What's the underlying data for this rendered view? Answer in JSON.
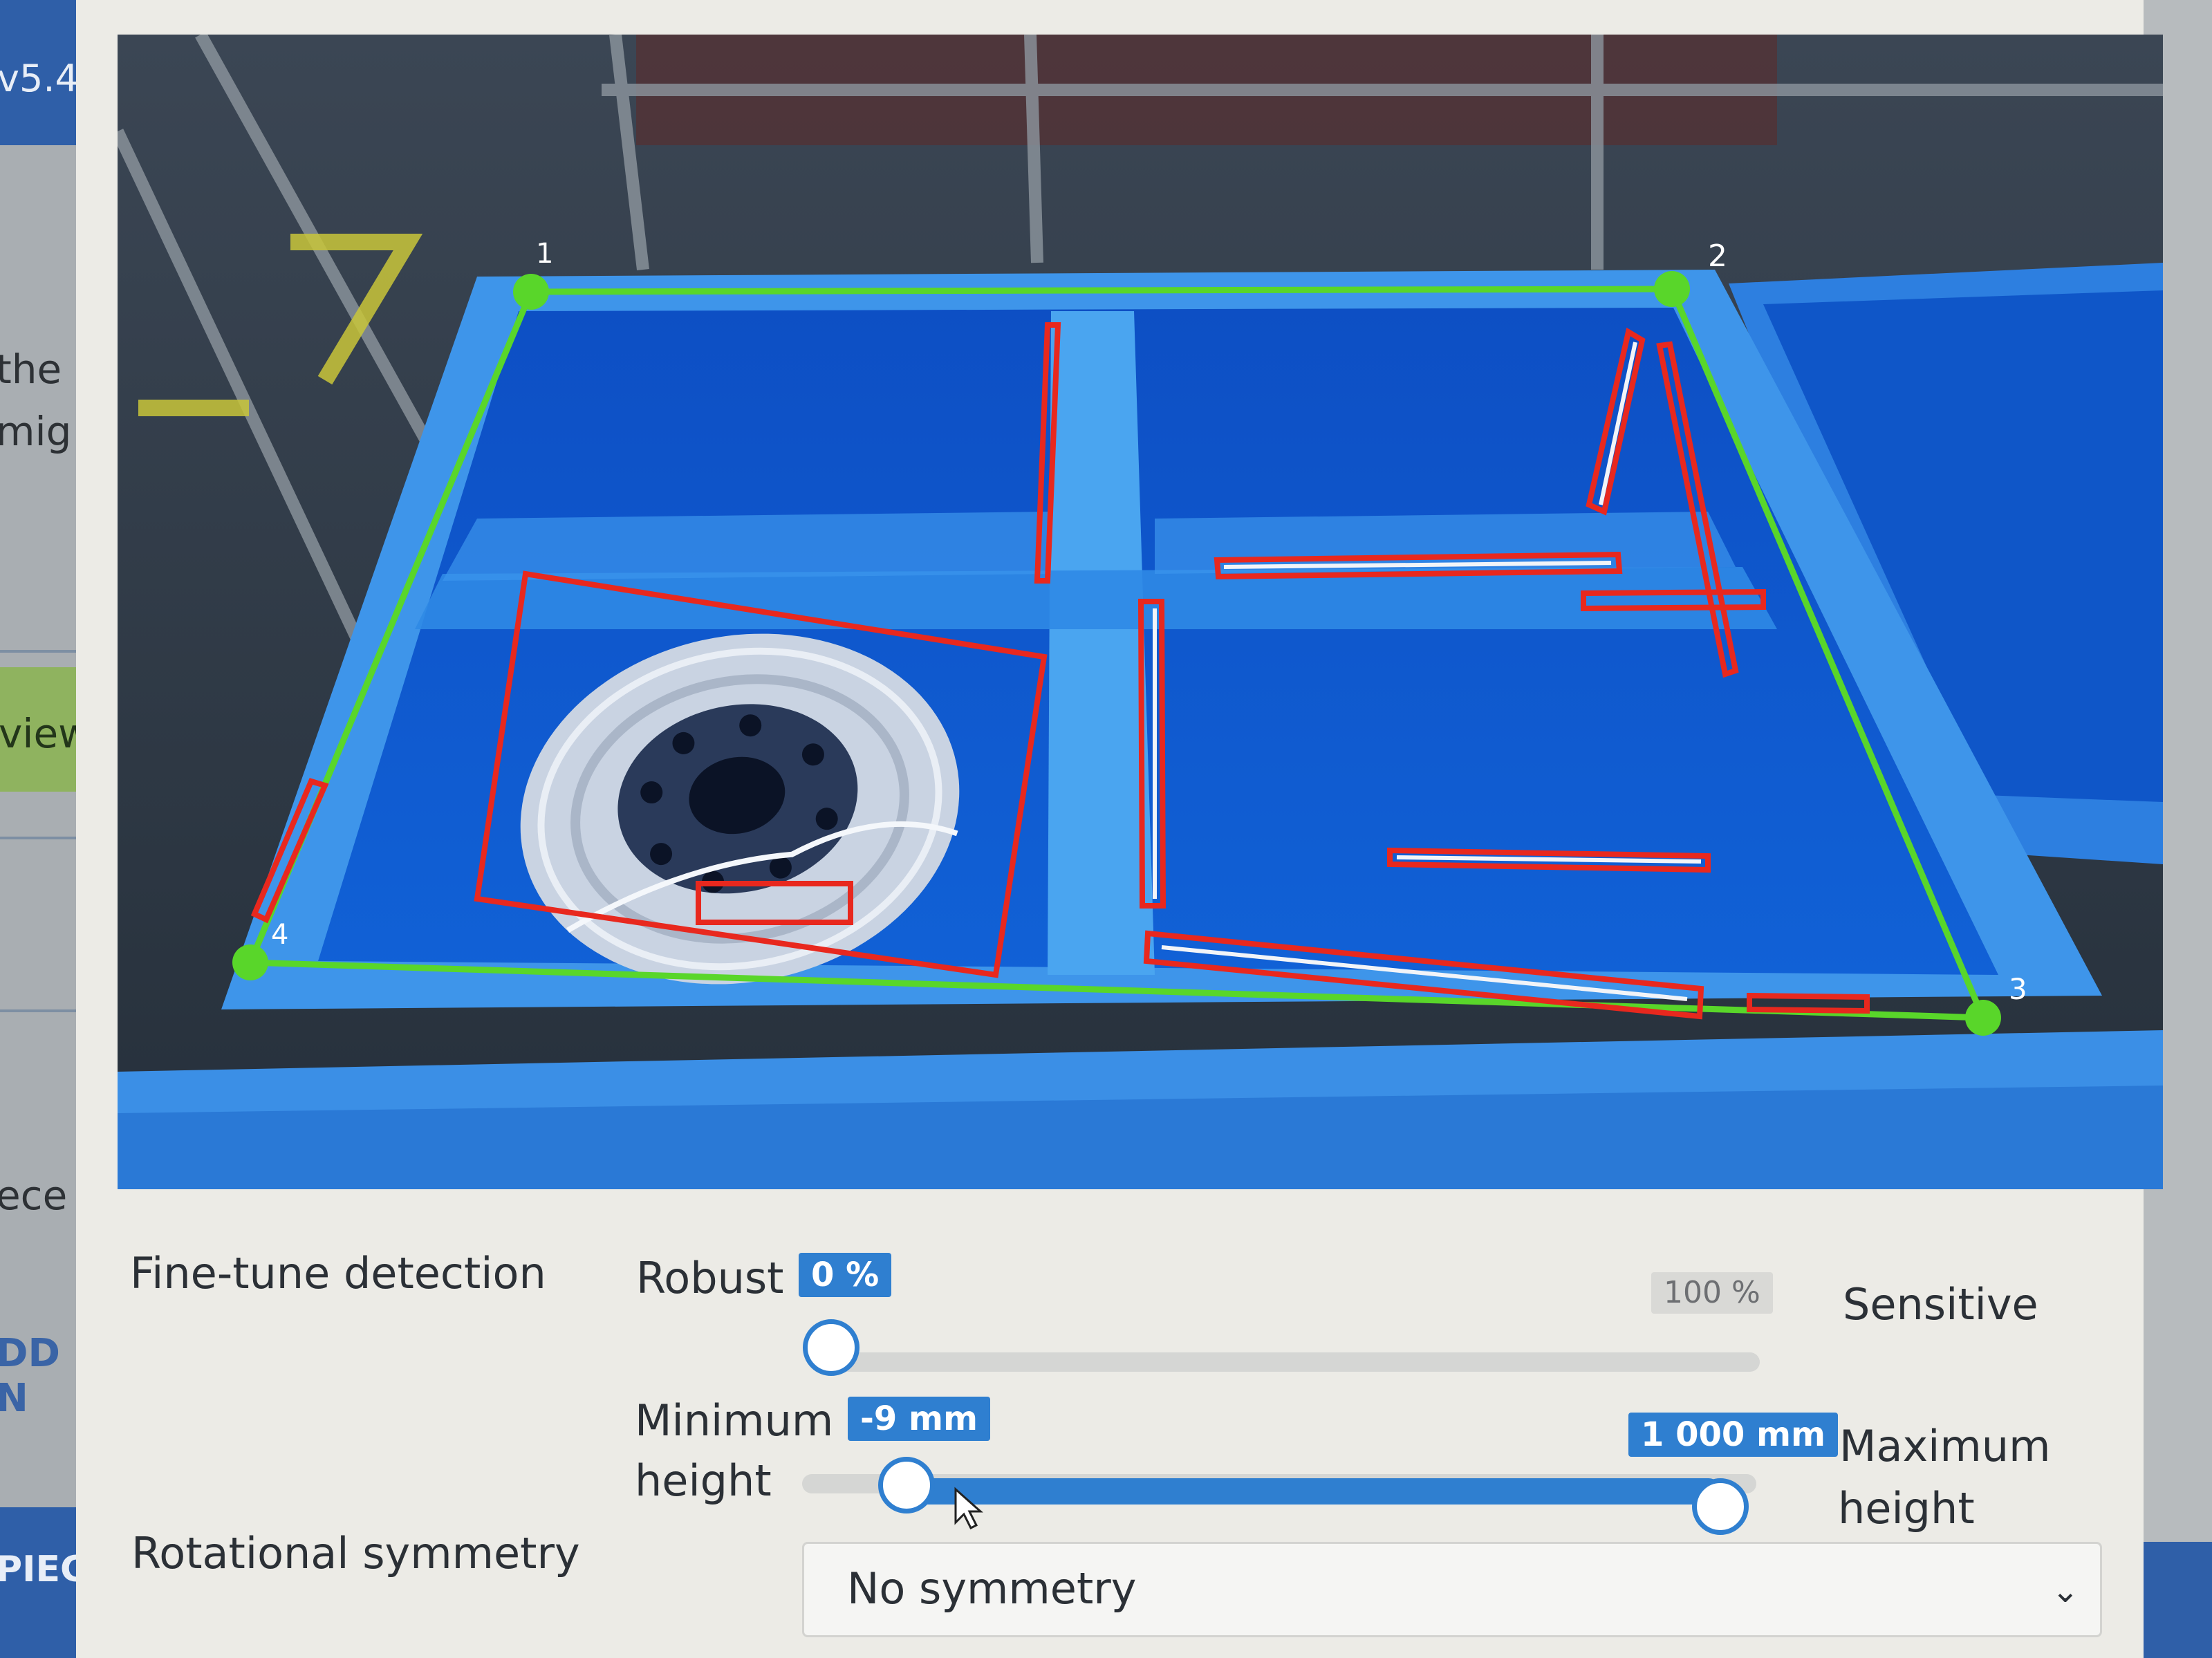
{
  "sidebar": {
    "version": "v5.4",
    "text_line_1": "the",
    "text_line_2": "mig",
    "view_label": "view",
    "piece_text": "ece",
    "add_button": "DD N",
    "piece_button": "PIECE"
  },
  "camera": {
    "corner_labels": [
      "1",
      "2",
      "3",
      "4"
    ]
  },
  "fine_tune": {
    "label": "Fine-tune detection",
    "left_label": "Robust",
    "right_label": "Sensitive",
    "value_badge": "0 %",
    "max_badge": "100 %",
    "value_percent": 0
  },
  "height_range": {
    "min_label_line1": "Minimum",
    "min_label_line2": "height",
    "max_label_line1": "Maximum",
    "max_label_line2": "height",
    "min_badge": "-9 mm",
    "max_badge": "1 000 mm"
  },
  "symmetry": {
    "label": "Rotational symmetry",
    "selected": "No symmetry"
  },
  "colors": {
    "accent": "#2f7fd0",
    "detection_outline": "#e8281e",
    "roi_outline": "#59d62a"
  }
}
